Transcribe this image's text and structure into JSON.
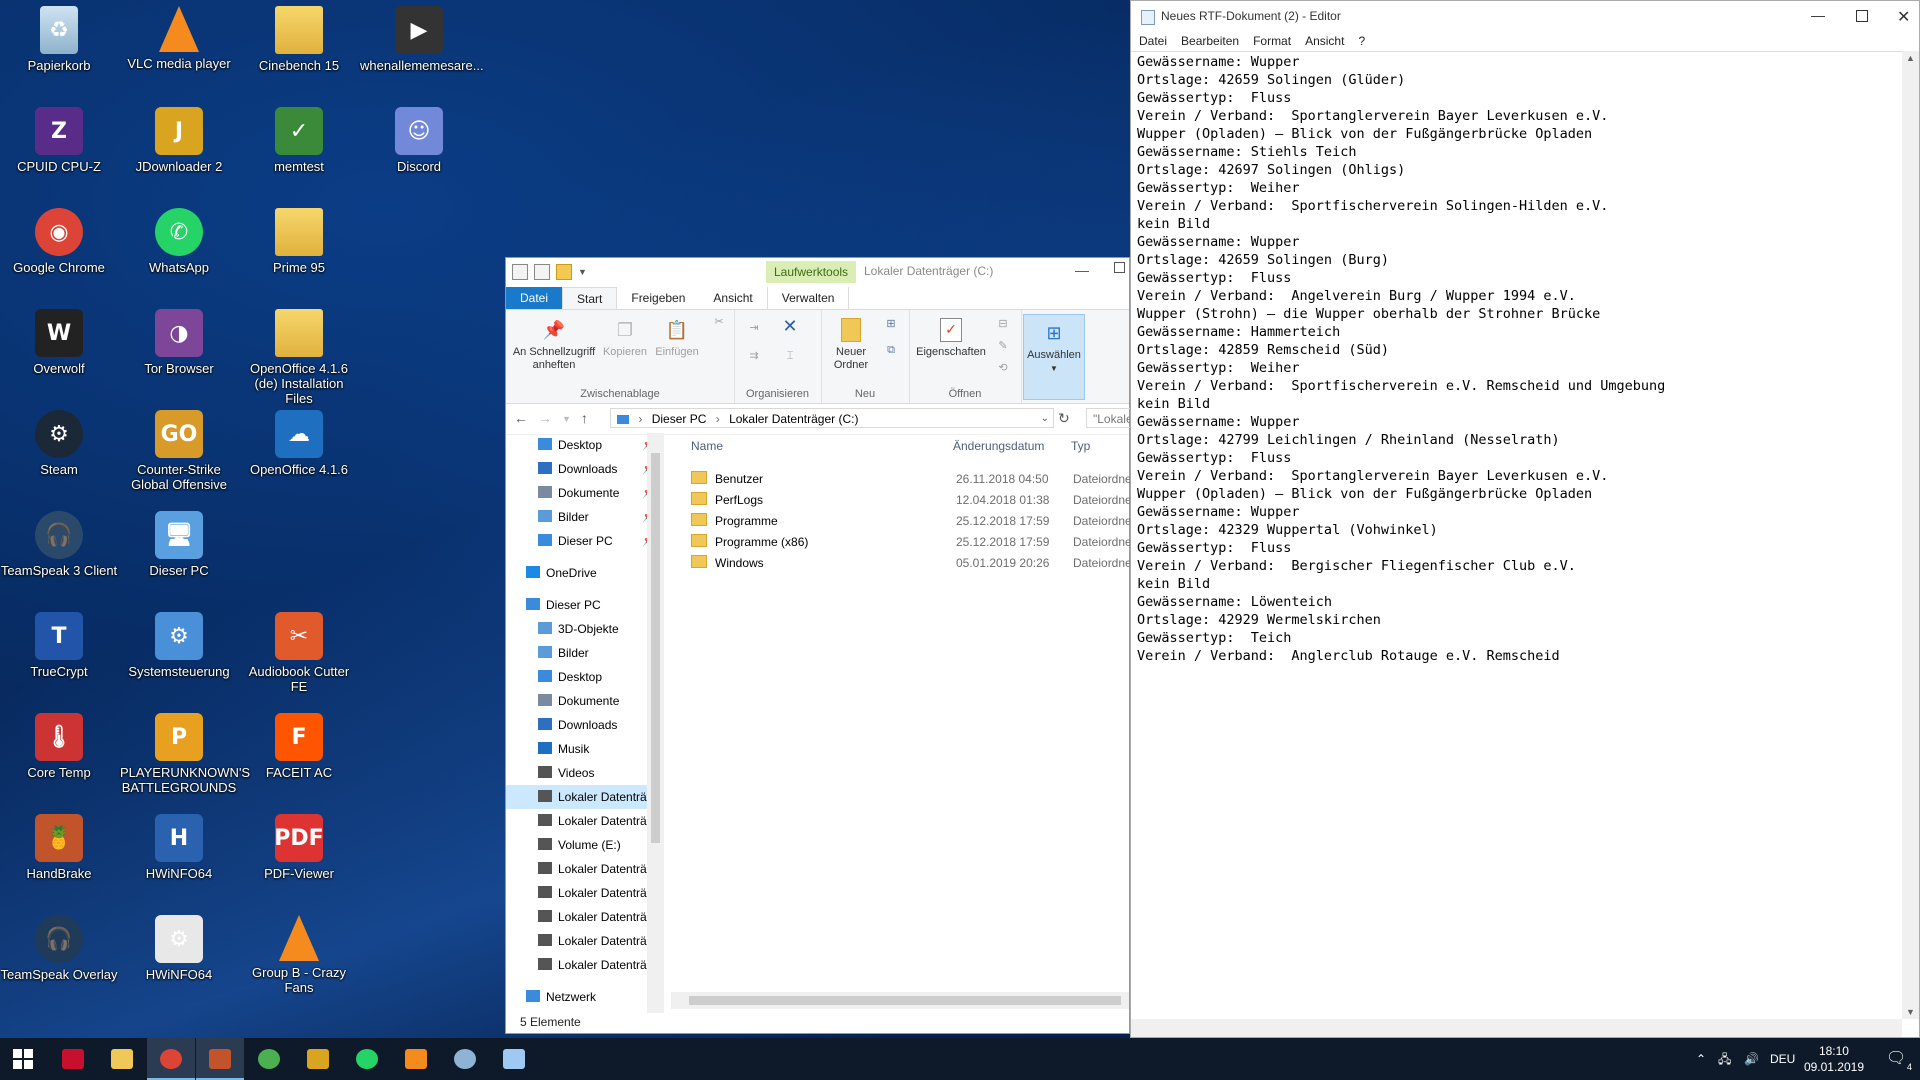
{
  "desktop": {
    "icons": [
      {
        "label": "Papierkorb",
        "icon": "recycle-bin-icon"
      },
      {
        "label": "VLC media player",
        "icon": "vlc-icon"
      },
      {
        "label": "Cinebench 15",
        "icon": "folder-icon"
      },
      {
        "label": "whenallememesare...",
        "icon": "video-file-icon"
      },
      {
        "label": "CPUID CPU-Z",
        "icon": "cpuz-icon"
      },
      {
        "label": "JDownloader 2",
        "icon": "jdownloader-icon"
      },
      {
        "label": "memtest",
        "icon": "memtest-icon"
      },
      {
        "label": "Discord",
        "icon": "discord-icon"
      },
      {
        "label": "Google Chrome",
        "icon": "chrome-icon"
      },
      {
        "label": "WhatsApp",
        "icon": "whatsapp-icon"
      },
      {
        "label": "Prime 95",
        "icon": "folder-icon"
      },
      {
        "label": "Overwolf",
        "icon": "overwolf-icon"
      },
      {
        "label": "Tor Browser",
        "icon": "tor-icon"
      },
      {
        "label": "OpenOffice 4.1.6 (de) Installation Files",
        "icon": "folder-icon"
      },
      {
        "label": "Steam",
        "icon": "steam-icon"
      },
      {
        "label": "Counter-Strike Global Offensive",
        "icon": "csgo-icon"
      },
      {
        "label": "OpenOffice 4.1.6",
        "icon": "openoffice-icon"
      },
      {
        "label": "TeamSpeak 3 Client",
        "icon": "teamspeak-icon"
      },
      {
        "label": "Dieser PC",
        "icon": "computer-icon"
      },
      {
        "label": "TrueCrypt",
        "icon": "truecrypt-icon"
      },
      {
        "label": "Systemsteuerung",
        "icon": "control-panel-icon"
      },
      {
        "label": "Audiobook Cutter FE",
        "icon": "audiobook-cutter-icon"
      },
      {
        "label": "Core Temp",
        "icon": "coretemp-icon"
      },
      {
        "label": "PLAYERUNKNOWN'S BATTLEGROUNDS",
        "icon": "pubg-icon"
      },
      {
        "label": "FACEIT AC",
        "icon": "faceit-icon"
      },
      {
        "label": "HandBrake",
        "icon": "handbrake-icon"
      },
      {
        "label": "HWiNFO64",
        "icon": "hwinfo-icon"
      },
      {
        "label": "PDF-Viewer",
        "icon": "pdf-icon"
      },
      {
        "label": "TeamSpeak Overlay",
        "icon": "teamspeak-overlay-icon"
      },
      {
        "label": "HWiNFO64",
        "icon": "file-icon"
      },
      {
        "label": "Group B - Crazy Fans",
        "icon": "vlc-icon"
      }
    ]
  },
  "explorer": {
    "context_tab": "Laufwerktools",
    "title": "Lokaler Datenträger (C:)",
    "tabs": {
      "file": "Datei",
      "start": "Start",
      "share": "Freigeben",
      "view": "Ansicht",
      "manage": "Verwalten"
    },
    "ribbon": {
      "pin_label": "An Schnellzugriff anheften",
      "copy_label": "Kopieren",
      "paste_label": "Einfügen",
      "group_clipboard": "Zwischenablage",
      "group_organize": "Organisieren",
      "new_folder_label": "Neuer Ordner",
      "group_new": "Neu",
      "properties_label": "Eigenschaften",
      "group_open": "Öffnen",
      "select_label": "Auswählen"
    },
    "address": {
      "crumb1": "Dieser PC",
      "crumb2": "Lokaler Datenträger (C:)"
    },
    "search_placeholder": "\"Lokale",
    "nav": [
      {
        "label": "Desktop",
        "pinned": true
      },
      {
        "label": "Downloads",
        "pinned": true
      },
      {
        "label": "Dokumente",
        "pinned": true
      },
      {
        "label": "Bilder",
        "pinned": true
      },
      {
        "label": "Dieser PC",
        "pinned": true
      },
      {
        "label": "OneDrive"
      },
      {
        "label": "Dieser PC"
      },
      {
        "label": "3D-Objekte"
      },
      {
        "label": "Bilder"
      },
      {
        "label": "Desktop"
      },
      {
        "label": "Dokumente"
      },
      {
        "label": "Downloads"
      },
      {
        "label": "Musik"
      },
      {
        "label": "Videos"
      },
      {
        "label": "Lokaler Datenträg"
      },
      {
        "label": "Lokaler Datenträg"
      },
      {
        "label": "Volume (E:)"
      },
      {
        "label": "Lokaler Datenträg"
      },
      {
        "label": "Lokaler Datenträg"
      },
      {
        "label": "Lokaler Datenträg"
      },
      {
        "label": "Lokaler Datenträg"
      },
      {
        "label": "Lokaler Datenträg"
      },
      {
        "label": "Netzwerk"
      }
    ],
    "columns": {
      "name": "Name",
      "date": "Änderungsdatum",
      "type": "Typ"
    },
    "files": [
      {
        "name": "Benutzer",
        "date": "26.11.2018 04:50",
        "type": "Dateiordner"
      },
      {
        "name": "PerfLogs",
        "date": "12.04.2018 01:38",
        "type": "Dateiordner"
      },
      {
        "name": "Programme",
        "date": "25.12.2018 17:59",
        "type": "Dateiordner"
      },
      {
        "name": "Programme (x86)",
        "date": "25.12.2018 17:59",
        "type": "Dateiordner"
      },
      {
        "name": "Windows",
        "date": "05.01.2019 20:26",
        "type": "Dateiordner"
      }
    ],
    "status": "5 Elemente"
  },
  "notepad": {
    "title": "Neues RTF-Dokument (2) - Editor",
    "menu": [
      "Datei",
      "Bearbeiten",
      "Format",
      "Ansicht",
      "?"
    ],
    "lines": [
      "Gewässername: Wupper",
      "Ortslage: 42659 Solingen (Glüder)",
      "Gewässertyp:  Fluss",
      "Verein / Verband:  Sportanglerverein Bayer Leverkusen e.V.",
      "Wupper (Opladen) – Blick von der Fußgängerbrücke Opladen",
      "Gewässername: Stiehls Teich",
      "Ortslage: 42697 Solingen (Ohligs)",
      "Gewässertyp:  Weiher",
      "Verein / Verband:  Sportfischerverein Solingen-Hilden e.V.",
      "kein Bild",
      "Gewässername: Wupper",
      "Ortslage: 42659 Solingen (Burg)",
      "Gewässertyp:  Fluss",
      "Verein / Verband:  Angelverein Burg / Wupper 1994 e.V.",
      "Wupper (Strohn) – die Wupper oberhalb der Strohner Brücke",
      "Gewässername: Hammerteich",
      "Ortslage: 42859 Remscheid (Süd)",
      "Gewässertyp:  Weiher",
      "Verein / Verband:  Sportfischerverein e.V. Remscheid und Umgebung",
      "kein Bild",
      "Gewässername: Wupper",
      "Ortslage: 42799 Leichlingen / Rheinland (Nesselrath)",
      "Gewässertyp:  Fluss",
      "Verein / Verband:  Sportanglerverein Bayer Leverkusen e.V.",
      "Wupper (Opladen) – Blick von der Fußgängerbrücke Opladen",
      "Gewässername: Wupper",
      "Ortslage: 42329 Wuppertal (Vohwinkel)",
      "Gewässertyp:  Fluss",
      "Verein / Verband:  Bergischer Fliegenfischer Club e.V.",
      "kein Bild",
      "Gewässername: Löwenteich",
      "Ortslage: 42929 Wermelskirchen",
      "Gewässertyp:  Teich",
      "Verein / Verband:  Anglerclub Rotauge e.V. Remscheid"
    ]
  },
  "taskbar": {
    "language": "DEU",
    "time": "18:10",
    "date": "09.01.2019",
    "notification_count": "4",
    "apps": [
      "start-icon",
      "msi-dragon-icon",
      "file-explorer-icon",
      "chrome-icon",
      "handbrake-icon",
      "globe-icon",
      "jdownloader-icon",
      "whatsapp-icon",
      "media-player-icon",
      "steam-icon",
      "notepad-icon"
    ]
  }
}
